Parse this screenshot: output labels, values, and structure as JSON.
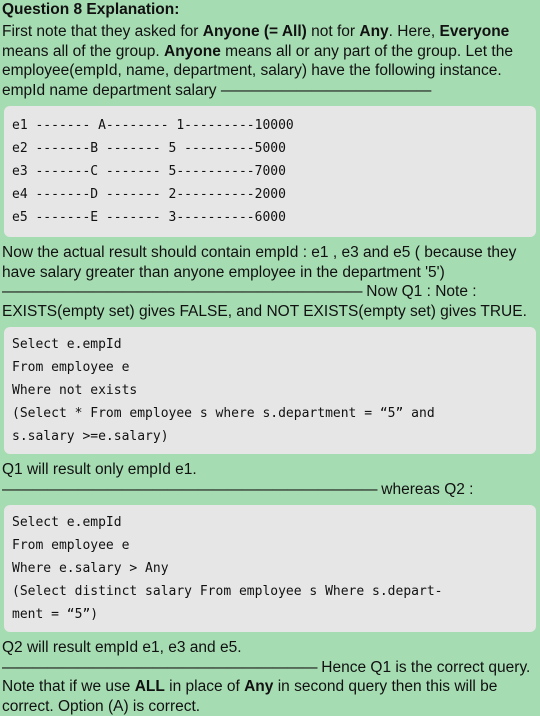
{
  "title": "Question 8 Explanation:",
  "intro": {
    "p1": "First note that they asked for ",
    "anyone_all": "Anyone (= All)",
    "p2": " not for ",
    "any": "Any",
    "p3": ". Here, ",
    "everyone": "Everyone",
    "p4": " means all of the group. ",
    "anyone": "Anyone",
    "p5": " means all or any part of the group. Let the employee(empId, name, department, salary) have the following instance.",
    "header_line": "empId name department salary ",
    "header_dashes": "——————————————"
  },
  "table_rows": [
    "e1 ------- A-------- 1---------10000",
    "e2 -------B ------- 5 ---------5000",
    "e3 -------C ------- 5----------7000",
    "e4 -------D ------- 2----------2000",
    "e5 -------E ------- 3----------6000"
  ],
  "middle": {
    "p1": "Now the actual result should contain empId : e1 , e3 and e5 ( because they have salary greater than anyone employee in the department '5') ",
    "dashes1": "——————",
    "dashes2": "——————————————————",
    "p2": " Now Q1 : Note : EXISTS(empty set) gives FALSE, and NOT EXISTS(empty set) gives TRUE."
  },
  "q1_code": [
    "Select e.empId",
    "From employee e",
    "Where not exists",
    "(Select * From employee s where s.department = “5” and",
    "s.salary >=e.salary)"
  ],
  "q1_result": {
    "text": "Q1 will result only empId e1. ",
    "dashes": "—————————————————————————",
    "tail": " whereas Q2 :"
  },
  "q2_code": [
    "Select e.empId",
    "From employee e",
    "Where e.salary > Any",
    "(Select distinct salary From employee s Where s.depart-",
    "ment = “5”)"
  ],
  "conclusion": {
    "p1": "Q2 will result empId e1, e3 and e5. ",
    "dashes": "—————————————————————",
    "p2": " Hence Q1 is the correct query. Note that if we use ",
    "all": "ALL",
    "p3": " in place of ",
    "any": "Any",
    "p4": " in second query then this will be correct. Option (A) is correct."
  }
}
